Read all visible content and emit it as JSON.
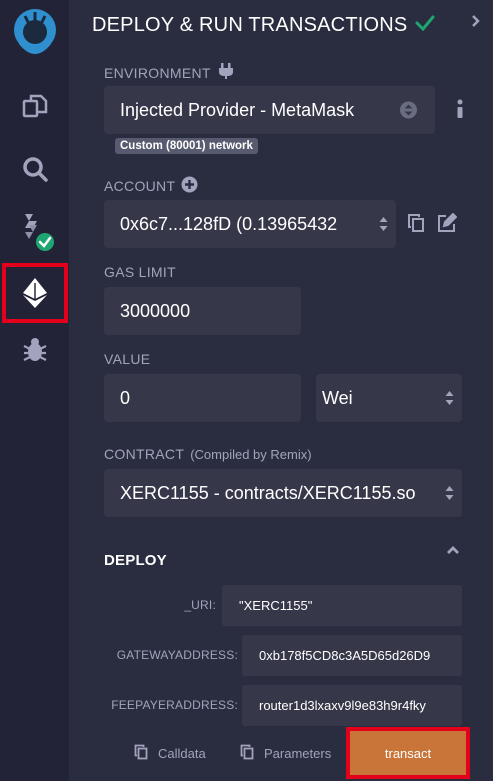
{
  "rail": {
    "items": [
      {
        "name": "remix-logo-icon"
      },
      {
        "name": "file-explorer-icon"
      },
      {
        "name": "search-icon"
      },
      {
        "name": "solidity-compiler-icon"
      },
      {
        "name": "deploy-run-icon"
      },
      {
        "name": "debugger-icon"
      }
    ]
  },
  "header": {
    "title": "DEPLOY & RUN TRANSACTIONS"
  },
  "environment": {
    "label": "ENVIRONMENT",
    "value": "Injected Provider - MetaMask",
    "network_badge": "Custom (80001) network"
  },
  "account": {
    "label": "ACCOUNT",
    "value": "0x6c7...128fD (0.13965432"
  },
  "gas_limit": {
    "label": "GAS LIMIT",
    "value": "3000000"
  },
  "value": {
    "label": "VALUE",
    "amount": "0",
    "unit": "Wei"
  },
  "contract": {
    "label": "CONTRACT",
    "sublabel": "(Compiled by Remix)",
    "value": "XERC1155 - contracts/XERC1155.so"
  },
  "deploy": {
    "title": "DEPLOY",
    "params": [
      {
        "label": "_URI:",
        "value": "\"XERC1155\""
      },
      {
        "label": "GATEWAYADDRESS:",
        "value": "0xb178f5CD8c3A5D65d26D9"
      },
      {
        "label": "FEEPAYERADDRESS:",
        "value": "router1d3lxaxv9l9e83h9r4fky"
      }
    ],
    "calldata_label": "Calldata",
    "parameters_label": "Parameters",
    "transact_label": "transact"
  },
  "colors": {
    "accent_green": "#1ea672",
    "transact": "#c97539",
    "highlight": "#e2001a",
    "logo_blue": "#2f8fcf"
  }
}
